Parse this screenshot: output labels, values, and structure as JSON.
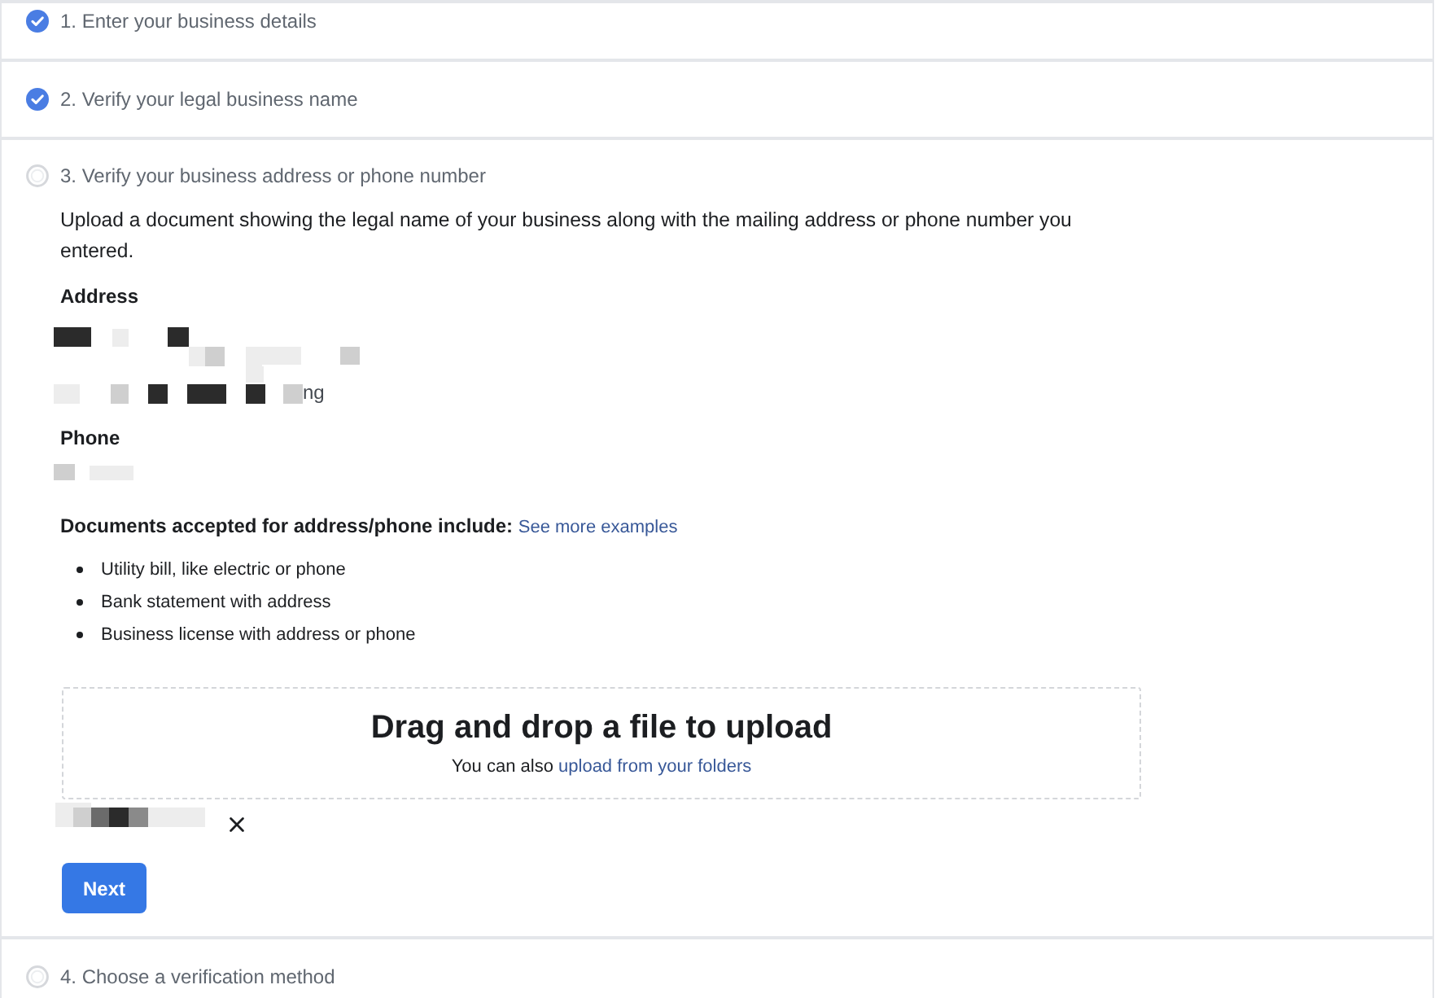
{
  "steps": [
    {
      "title": "1. Enter your business details",
      "completed": true
    },
    {
      "title": "2. Verify your legal business name",
      "completed": true
    },
    {
      "title": "3. Verify your business address or phone number",
      "completed": false,
      "body": {
        "intro": "Upload a document showing the legal name of your business along with the mailing address or phone number you entered.",
        "address": {
          "label": "Address",
          "visible_fragment": "ng"
        },
        "phone": {
          "label": "Phone"
        },
        "documents": {
          "label": "Documents accepted for address/phone include:",
          "link": "See more examples",
          "items": [
            "Utility bill, like electric or phone",
            "Bank statement with address",
            "Business license with address or phone"
          ]
        },
        "upload": {
          "title": "Drag and drop a file to upload",
          "hint": "You can also",
          "link": "upload from your folders"
        },
        "button": "Next"
      }
    },
    {
      "title": "4. Choose a verification method",
      "completed": false
    }
  ]
}
